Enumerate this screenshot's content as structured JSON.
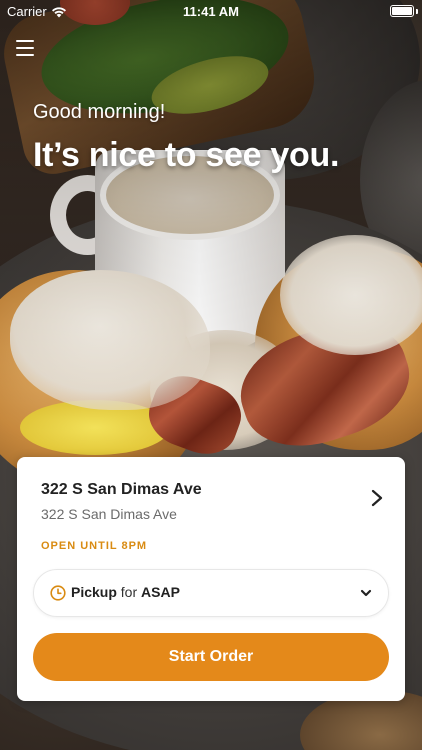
{
  "status_bar": {
    "carrier": "Carrier",
    "time": "11:41 AM"
  },
  "header": {
    "greeting": "Good morning!",
    "headline": "It’s nice to see you."
  },
  "location": {
    "name": "322 S San Dimas Ave",
    "address": "322 S San Dimas Ave",
    "hours": "OPEN UNTIL 8PM"
  },
  "order_mode": {
    "mode": "Pickup",
    "connector": "for",
    "time": "ASAP"
  },
  "actions": {
    "start_order": "Start Order"
  },
  "icons": {
    "menu": "hamburger-menu-icon",
    "wifi": "wifi-icon",
    "battery": "battery-icon",
    "location_chevron": "chevron-right-icon",
    "clock": "clock-icon",
    "dropdown": "chevron-down-icon"
  },
  "colors": {
    "accent": "#e4891a",
    "hours_text": "#d98b12",
    "card_background": "#ffffff"
  }
}
